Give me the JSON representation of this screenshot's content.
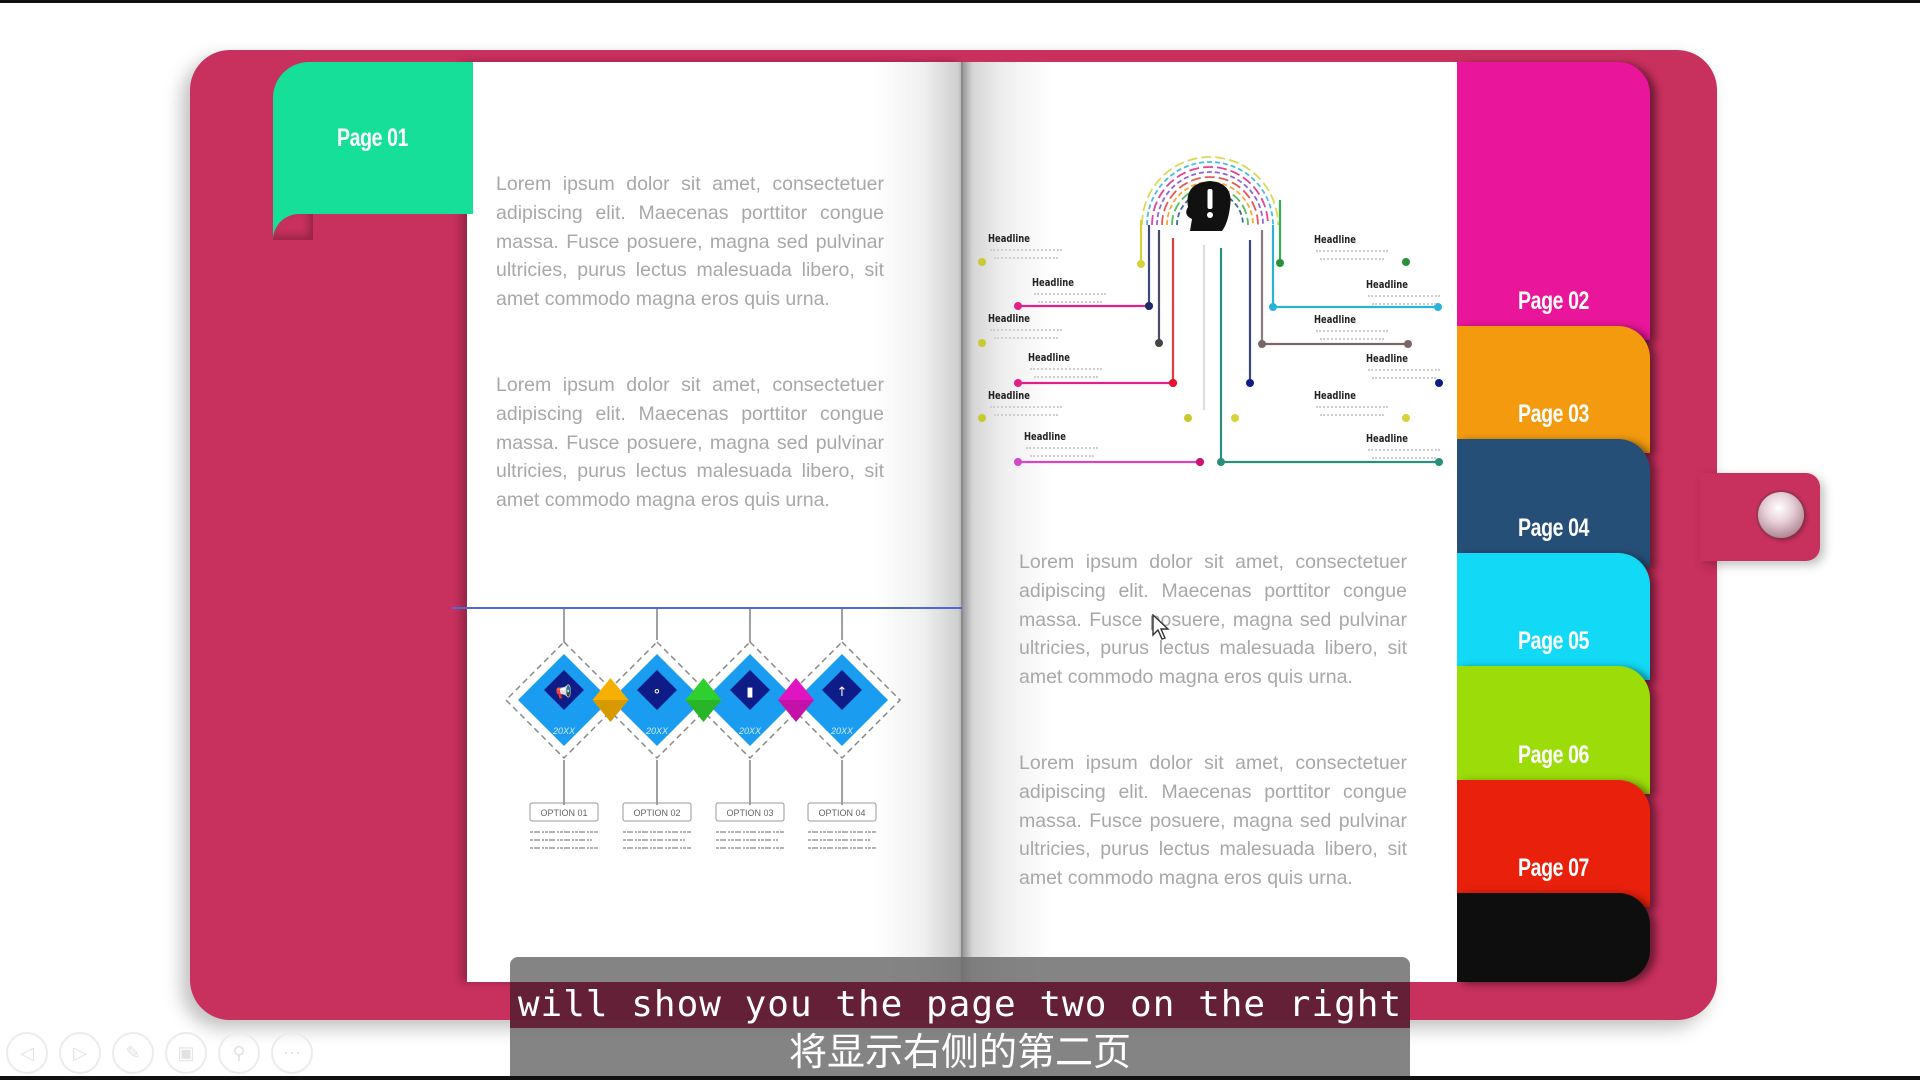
{
  "book": {
    "left_tab": {
      "label": "Page 01",
      "color": "#16df9a"
    },
    "right_tabs": [
      {
        "label": "Page 02",
        "color": "#e9159a"
      },
      {
        "label": "Page 03",
        "color": "#f39a0e"
      },
      {
        "label": "Page 04",
        "color": "#264f78"
      },
      {
        "label": "Page 05",
        "color": "#12d9f5"
      },
      {
        "label": "Page 06",
        "color": "#9cdc09"
      },
      {
        "label": "Page 07",
        "color": "#e8200c"
      },
      {
        "label": "",
        "color": "#0e0e0e"
      }
    ],
    "cover_color": "#c8305e"
  },
  "left_page": {
    "paragraphs": [
      "Lorem ipsum dolor sit amet, consectetuer adipiscing elit. Maecenas porttitor congue massa. Fusce posuere, magna sed pulvinar ultricies, purus lectus malesuada libero, sit amet commodo magna eros quis urna.",
      "Lorem ipsum dolor sit amet, consectetuer adipiscing elit. Maecenas porttitor congue massa. Fusce posuere, magna sed pulvinar ultricies, purus lectus malesuada libero, sit amet commodo magna eros quis urna."
    ],
    "timeline": {
      "items": [
        {
          "option": "OPTION 01",
          "year": "20XX",
          "icon": "megaphone-icon"
        },
        {
          "option": "OPTION 02",
          "year": "20XX",
          "icon": "network-icon"
        },
        {
          "option": "OPTION 03",
          "year": "20XX",
          "icon": "bar-chart-icon"
        },
        {
          "option": "OPTION 04",
          "year": "20XX",
          "icon": "person-icon"
        }
      ],
      "connector_colors": [
        "#f5b000",
        "#2fcf2f",
        "#e014c0"
      ]
    }
  },
  "right_page": {
    "infographic": {
      "center_icon": "head-exclamation-icon",
      "headlines_left": [
        "Headline",
        "Headline",
        "Headline",
        "Headline",
        "Headline",
        "Headline"
      ],
      "headlines_right": [
        "Headline",
        "Headline",
        "Headline",
        "Headline",
        "Headline",
        "Headline"
      ]
    },
    "paragraphs": [
      "Lorem ipsum dolor sit amet, consectetuer adipiscing elit. Maecenas porttitor congue massa. Fusce posuere, magna sed pulvinar ultricies, purus lectus malesuada libero, sit amet commodo magna eros quis urna.",
      "Lorem ipsum dolor sit amet, consectetuer adipiscing elit. Maecenas porttitor congue massa. Fusce posuere, magna sed pulvinar ultricies, purus lectus malesuada libero, sit amet commodo magna eros quis urna."
    ]
  },
  "subtitle": {
    "english": "will show you the page two on the right",
    "chinese": "将显示右侧的第二页"
  },
  "controls": [
    {
      "name": "previous-slide",
      "glyph": "◁"
    },
    {
      "name": "next-slide",
      "glyph": "▷"
    },
    {
      "name": "pen",
      "glyph": "✎"
    },
    {
      "name": "slides",
      "glyph": "▣"
    },
    {
      "name": "zoom",
      "glyph": "⚲"
    },
    {
      "name": "more",
      "glyph": "⋯"
    }
  ]
}
